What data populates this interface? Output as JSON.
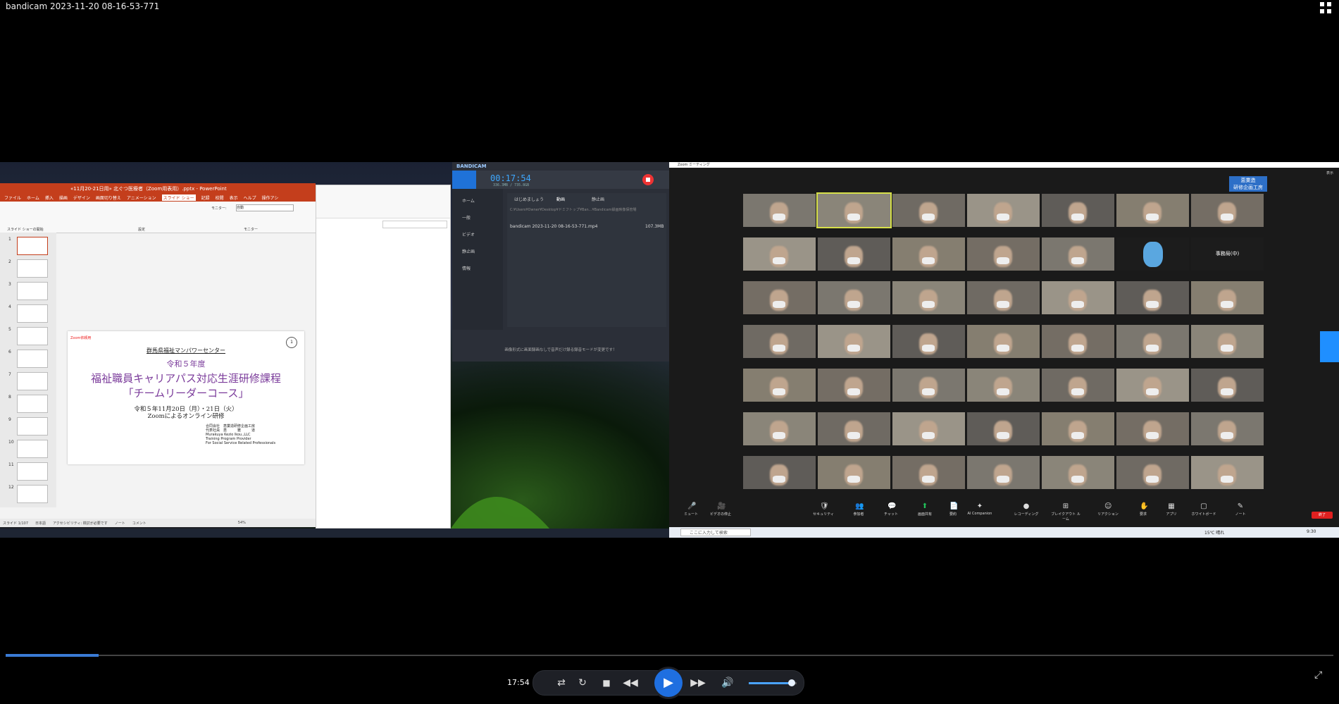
{
  "window": {
    "title": "bandicam 2023-11-20 08-16-53-771"
  },
  "ppt": {
    "titlebar": "«11月20-21日用» 北ぐつ医療者（Zoom用表用）.pptx - PowerPoint",
    "menu": [
      "ファイル",
      "ホーム",
      "挿入",
      "描画",
      "デザイン",
      "画面切り替え",
      "アニメーション",
      "スライド ショー",
      "記録",
      "校閲",
      "表示",
      "ヘルプ",
      "操作アシ"
    ],
    "ribbon_groups": [
      "スライド ショーの開始",
      "設定",
      "モニター"
    ],
    "monitor_label": "モニター:",
    "monitor_value": "自動",
    "thumbs": [
      "1",
      "2",
      "3",
      "4",
      "5",
      "6",
      "7",
      "8",
      "9",
      "10",
      "11",
      "12"
    ],
    "slide": {
      "tag": "Zoom依頼用",
      "badge": "1",
      "org": "群馬県福祉マンパワーセンター",
      "year": "令和５年度",
      "title1": "福祉職員キャリアパス対応生涯研修課程",
      "title2": "「チームリーダーコース」",
      "date": "令和５年11月20日（月）・21日（火）",
      "online": "Zoomによるオンライン研修",
      "company_lines": [
        "合同会社　恵業造研修企画工房",
        "代表社員　恵　　　雅　　　道",
        "Murakuya Kezio lkou.,LLC",
        "Training Program Provider",
        "For Social Service Related Professionals"
      ]
    },
    "status": [
      "スライド 1/107",
      "日本語",
      "アクセシビリティ: 検討が必要です",
      "ノート",
      "コメント",
      "54%"
    ]
  },
  "bandicam": {
    "title": "BANDICAM",
    "timer": "00:17:54",
    "size": "336.3MB / 735.8GB",
    "nav": [
      "ホーム",
      "一般",
      "ビデオ",
      "静止画",
      "情報"
    ],
    "tabs": [
      "はじめましょう",
      "動画",
      "静止画"
    ],
    "path": "C:¥Users¥Owner¥Desktop¥ドミフトップ¥Ban...¥Bandicam録画映像保管場",
    "file": "bandicam 2023-11-20 08-16-53-771.mp4",
    "file_size": "107.3MB",
    "footer": "画像形式に画面録画なしで音声だけ録る録音モードが変更です！"
  },
  "zoom": {
    "title": "Zoom ミーティング",
    "host_tag": "恵業造\n研修企画工房",
    "named_tile": "事務局(中)",
    "toolbar": [
      "ミュート",
      "ビデオの停止",
      "セキュリティ",
      "参加者",
      "チャット",
      "画面共有",
      "要約",
      "AI Companion",
      "レコーディング",
      "ブレイクアウト ルーム",
      "リアクション",
      "要求",
      "アプリ",
      "ホワイトボード",
      "ノート"
    ],
    "end": "終了",
    "search": "ここに入力して検索",
    "weather": "15℃ 晴れ",
    "clock": "9:30",
    "display_label": "表示"
  },
  "player": {
    "time": "17:54",
    "progress": 0.07,
    "volume": 0.9
  },
  "colors": {
    "accent": "#1f6fe0",
    "ppt": "#c43e1c",
    "zoom_end": "#e02020"
  }
}
